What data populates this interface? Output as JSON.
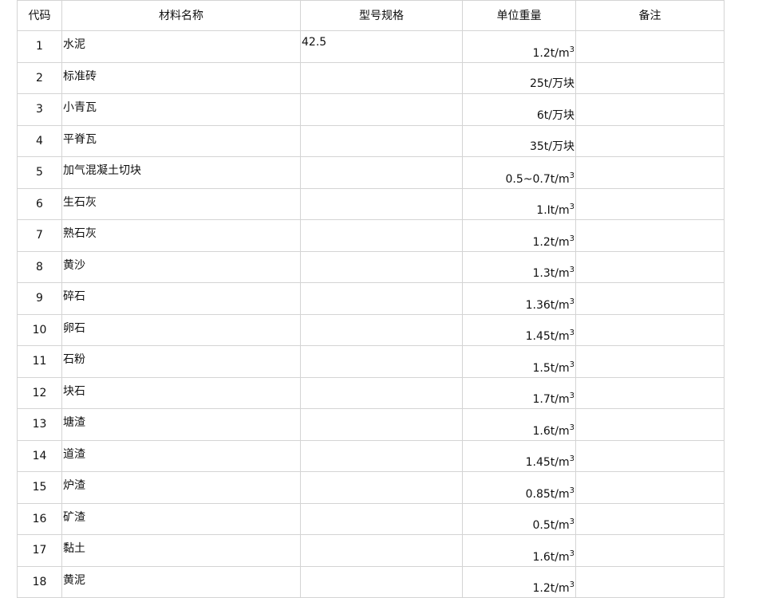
{
  "table": {
    "headers": [
      "代码",
      "材料名称",
      "型号规格",
      "单位重量",
      "备注"
    ],
    "rows": [
      {
        "code": "1",
        "name": "水泥",
        "spec": "42.5",
        "unit": "1.2t/m",
        "sup": "3",
        "note": ""
      },
      {
        "code": "2",
        "name": "标准砖",
        "spec": "",
        "unit": "25t/万块",
        "sup": "",
        "note": ""
      },
      {
        "code": "3",
        "name": "小青瓦",
        "spec": "",
        "unit": "6t/万块",
        "sup": "",
        "note": ""
      },
      {
        "code": "4",
        "name": "平脊瓦",
        "spec": "",
        "unit": "35t/万块",
        "sup": "",
        "note": ""
      },
      {
        "code": "5",
        "name": "加气混凝土切块",
        "spec": "",
        "unit": "0.5~0.7t/m",
        "sup": "3",
        "note": ""
      },
      {
        "code": "6",
        "name": "生石灰",
        "spec": "",
        "unit": "1.It/m",
        "sup": "3",
        "note": ""
      },
      {
        "code": "7",
        "name": "熟石灰",
        "spec": "",
        "unit": "1.2t/m",
        "sup": "3",
        "note": ""
      },
      {
        "code": "8",
        "name": "黄沙",
        "spec": "",
        "unit": "1.3t/m",
        "sup": "3",
        "note": ""
      },
      {
        "code": "9",
        "name": "碎石",
        "spec": "",
        "unit": "1.36t/m",
        "sup": "3",
        "note": ""
      },
      {
        "code": "10",
        "name": "卵石",
        "spec": "",
        "unit": "1.45t/m",
        "sup": "3",
        "note": ""
      },
      {
        "code": "11",
        "name": "石粉",
        "spec": "",
        "unit": "1.5t/m",
        "sup": "3",
        "note": ""
      },
      {
        "code": "12",
        "name": "块石",
        "spec": "",
        "unit": "1.7t/m",
        "sup": "3",
        "note": ""
      },
      {
        "code": "13",
        "name": "塘渣",
        "spec": "",
        "unit": "1.6t/m",
        "sup": "3",
        "note": ""
      },
      {
        "code": "14",
        "name": "道渣",
        "spec": "",
        "unit": "1.45t/m",
        "sup": "3",
        "note": ""
      },
      {
        "code": "15",
        "name": "炉渣",
        "spec": "",
        "unit": "0.85t/m",
        "sup": "3",
        "note": ""
      },
      {
        "code": "16",
        "name": "矿渣",
        "spec": "",
        "unit": "0.5t/m",
        "sup": "3",
        "note": ""
      },
      {
        "code": "17",
        "name": "黏土",
        "spec": "",
        "unit": "1.6t/m",
        "sup": "3",
        "note": ""
      },
      {
        "code": "18",
        "name": "黄泥",
        "spec": "",
        "unit": "1.2t/m",
        "sup": "3",
        "note": ""
      }
    ]
  }
}
